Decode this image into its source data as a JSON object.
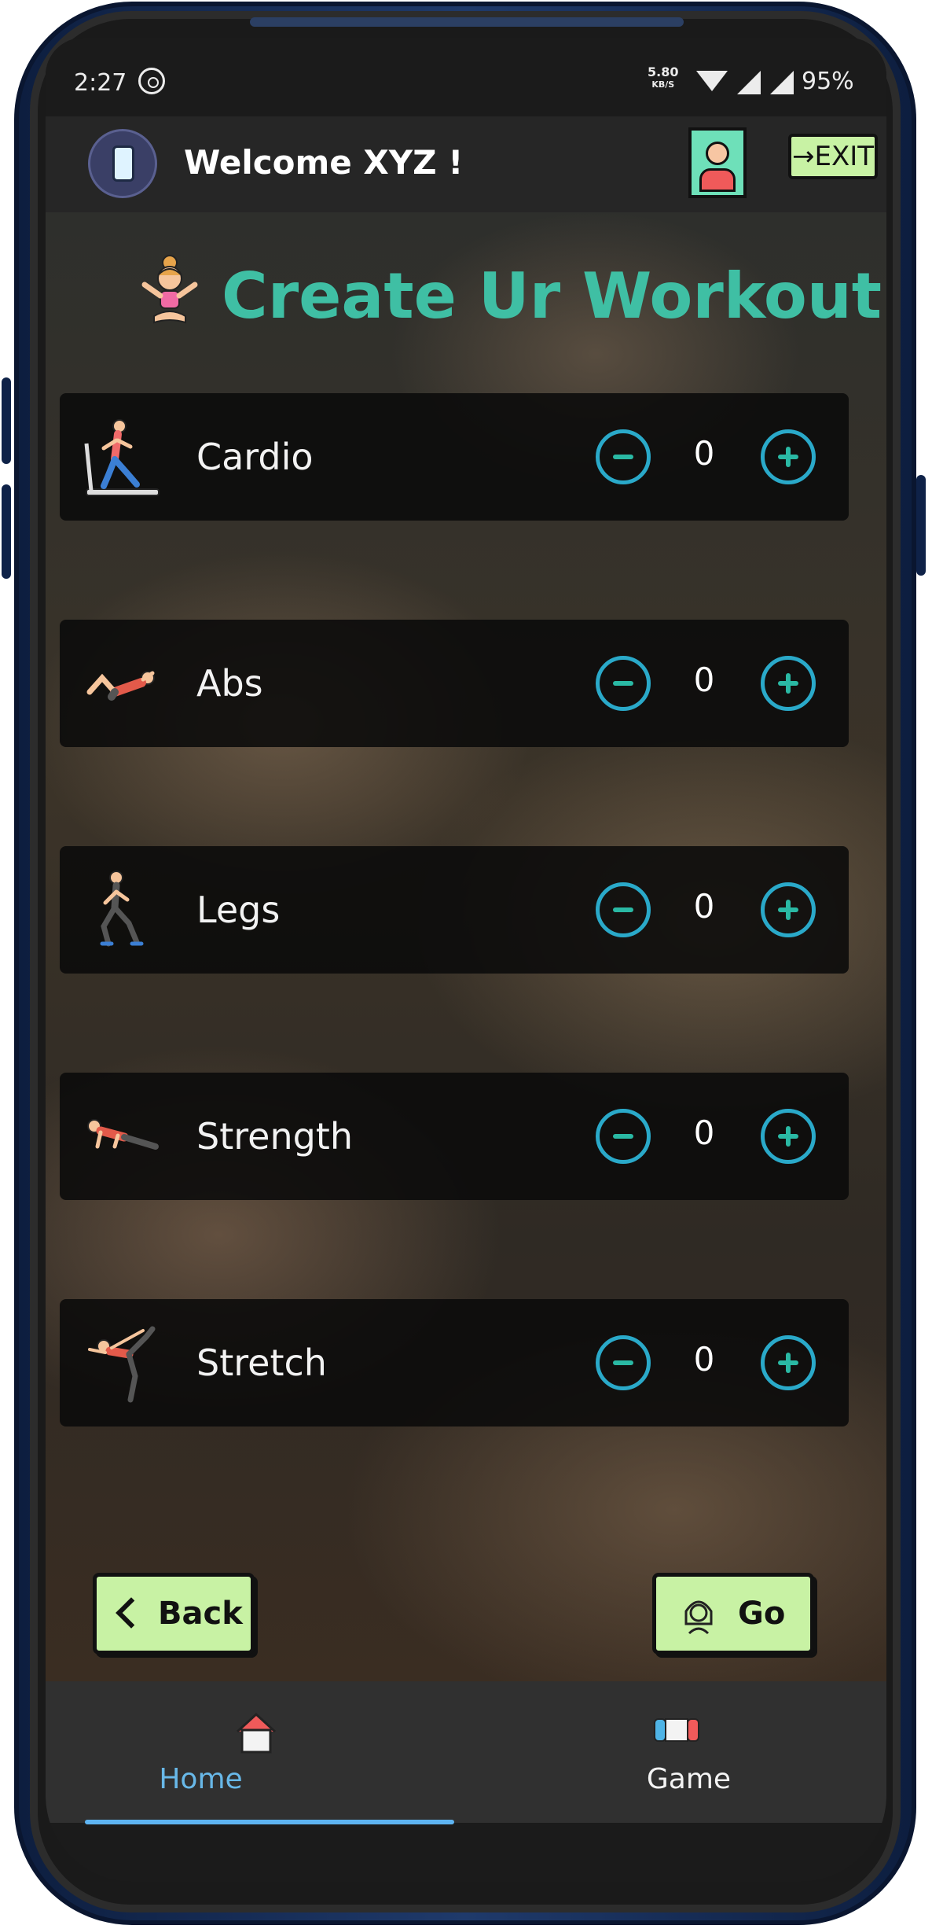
{
  "status_bar": {
    "time": "2:27",
    "net_speed": "5.80",
    "net_unit": "KB/S",
    "battery": "95%"
  },
  "header": {
    "welcome": "Welcome XYZ !",
    "exit_label": "→EXIT"
  },
  "page": {
    "title": "Create Ur Workout"
  },
  "exercises": [
    {
      "label": "Cardio",
      "count": "0"
    },
    {
      "label": "Abs",
      "count": "0"
    },
    {
      "label": "Legs",
      "count": "0"
    },
    {
      "label": "Strength",
      "count": "0"
    },
    {
      "label": "Stretch",
      "count": "0"
    }
  ],
  "actions": {
    "back_label": "Back",
    "go_label": "Go"
  },
  "bottom_nav": {
    "home_label": "Home",
    "game_label": "Game",
    "active": "Home"
  },
  "colors": {
    "accent_title": "#3fbfa4",
    "button_green": "#c8f2a4",
    "nav_active": "#68b8e8",
    "stepper_ring": "#2aa9c9"
  }
}
